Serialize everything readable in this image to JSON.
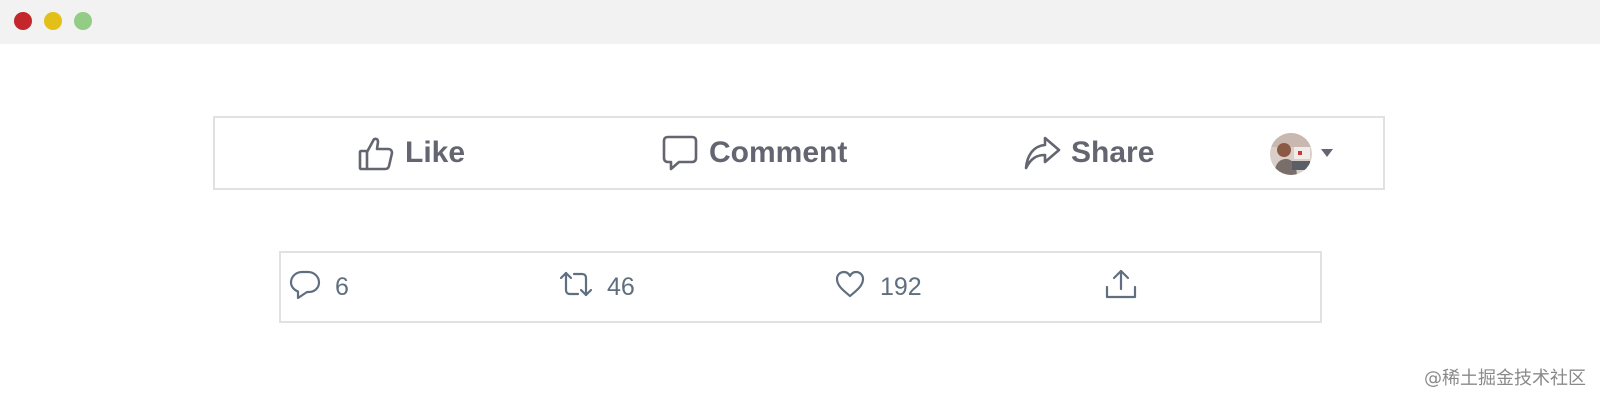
{
  "window": {
    "controls": [
      "close",
      "minimize",
      "maximize"
    ]
  },
  "facebook_bar": {
    "like_label": "Like",
    "comment_label": "Comment",
    "share_label": "Share",
    "icons": [
      "thumbs-up-icon",
      "comment-icon",
      "share-arrow-icon",
      "chevron-down-icon"
    ],
    "text_color": "#636670"
  },
  "twitter_bar": {
    "reply_count": "6",
    "retweet_count": "46",
    "like_count": "192",
    "icons": [
      "reply-icon",
      "retweet-icon",
      "heart-icon",
      "upload-icon"
    ],
    "text_color": "#5f6f80"
  },
  "watermark": "@稀土掘金技术社区",
  "colors": {
    "close": "#c3262b",
    "minimize": "#e2c018",
    "maximize": "#93cc84",
    "border": "#e1e1e3"
  }
}
